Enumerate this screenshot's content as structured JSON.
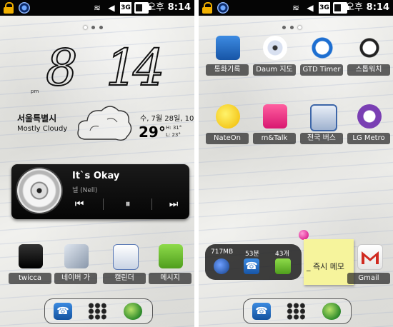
{
  "status_bar": {
    "ampm": "오후",
    "time": "8:14",
    "network": "3G"
  },
  "left_screen": {
    "clock": {
      "hour": "8",
      "minute_tens": "1",
      "minute_ones": "4",
      "ampm": "pm"
    },
    "weather": {
      "city": "서울특별시",
      "condition": "Mostly Cloudy",
      "date": "수, 7월 28일, 10",
      "temp": "29°",
      "high": "H: 31°",
      "low": "L: 23°"
    },
    "music": {
      "title": "It`s Okay",
      "artist": "넬 (Nell)"
    },
    "apps": [
      {
        "label": "twicca",
        "icon": "twicca-icon"
      },
      {
        "label": "네이버 가",
        "icon": "naver-wallet-icon"
      },
      {
        "label": "캘린더",
        "icon": "calendar-icon"
      },
      {
        "label": "메시지",
        "icon": "message-icon"
      }
    ]
  },
  "right_screen": {
    "apps_row1": [
      {
        "label": "통화기록",
        "icon": "call-log-icon"
      },
      {
        "label": "Daum 지도",
        "icon": "daum-map-icon"
      },
      {
        "label": "GTD Timer",
        "icon": "timer-icon"
      },
      {
        "label": "스톱워치",
        "icon": "stopwatch-icon"
      }
    ],
    "apps_row2": [
      {
        "label": "NateOn",
        "icon": "nateon-icon"
      },
      {
        "label": "m&Talk",
        "icon": "mtalk-icon"
      },
      {
        "label": "전국 버스",
        "icon": "bus-icon"
      },
      {
        "label": "LG Metro",
        "icon": "metro-icon"
      }
    ],
    "status_widget": {
      "memory": "717MB",
      "call_minutes": "53분",
      "sms_count": "43개"
    },
    "memo": {
      "text": "_ 즉시 메모"
    },
    "gmail": {
      "label": "Gmail"
    }
  },
  "colors": {
    "statusbar_bg": "#050505",
    "accent_blue": "#1e6fd1",
    "message_green": "#6abf2e",
    "memo_yellow": "#f6f49c"
  }
}
